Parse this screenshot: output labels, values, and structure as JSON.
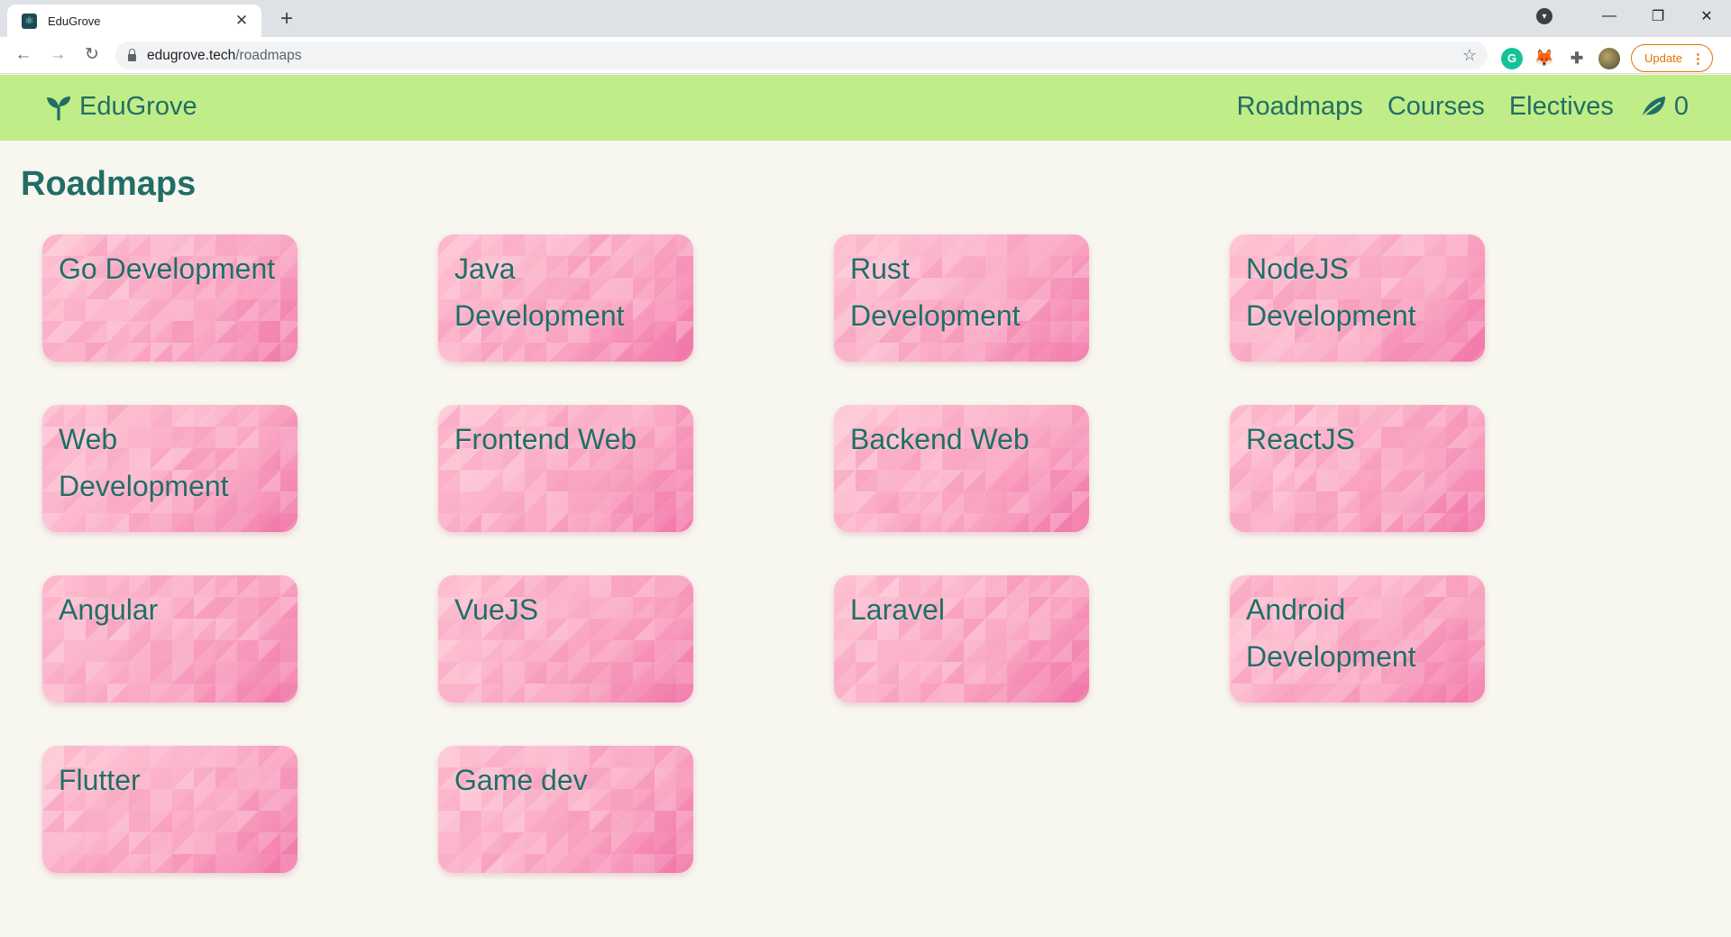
{
  "browser": {
    "tab_title": "EduGrove",
    "url_host": "edugrove.tech",
    "url_path": "/roadmaps",
    "update_label": "Update",
    "extensions": [
      "grammarly-icon",
      "metamask-icon",
      "puzzle-icon",
      "profile-avatar"
    ]
  },
  "header": {
    "brand": "EduGrove",
    "nav": [
      {
        "label": "Roadmaps"
      },
      {
        "label": "Courses"
      },
      {
        "label": "Electives"
      }
    ],
    "leaf_count": "0"
  },
  "main": {
    "title": "Roadmaps",
    "roadmaps": [
      {
        "title": "Go Development"
      },
      {
        "title": "Java Development"
      },
      {
        "title": "Rust Development"
      },
      {
        "title": "NodeJS Development"
      },
      {
        "title": "Web Development"
      },
      {
        "title": "Frontend Web"
      },
      {
        "title": "Backend Web"
      },
      {
        "title": "ReactJS"
      },
      {
        "title": "Angular"
      },
      {
        "title": "VueJS"
      },
      {
        "title": "Laravel"
      },
      {
        "title": "Android Development"
      },
      {
        "title": "Flutter"
      },
      {
        "title": "Game dev"
      }
    ]
  },
  "colors": {
    "header_bg": "#c0ed87",
    "brand_text": "#216e66",
    "page_bg": "#f7f6ef",
    "card_pink": "#f9a3c1"
  }
}
